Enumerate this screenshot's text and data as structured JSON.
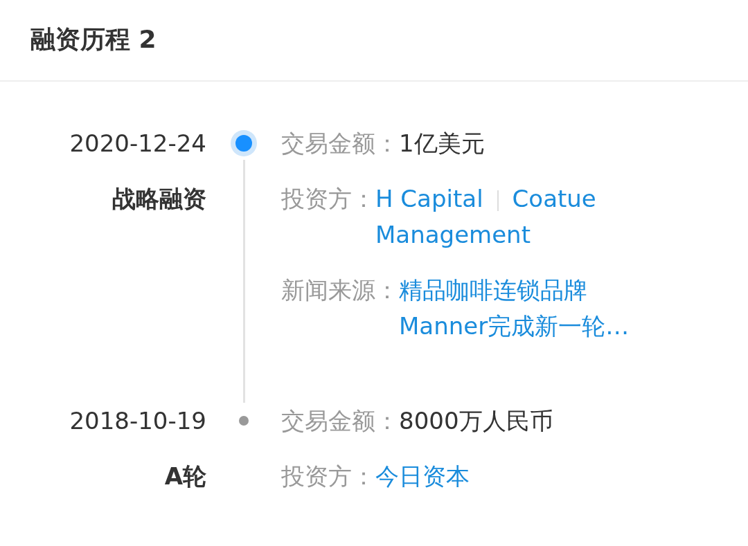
{
  "header": {
    "title": "融资历程 2"
  },
  "events": [
    {
      "date": "2020-12-24",
      "round": "战略融资",
      "active": true,
      "fields": [
        {
          "kind": "text",
          "label": "交易金额：",
          "value": "1亿美元"
        },
        {
          "kind": "links",
          "label": "投资方：",
          "links": [
            "H Capital",
            "Coatue Management"
          ]
        },
        {
          "kind": "link",
          "label": "新闻来源：",
          "value": "精品咖啡连锁品牌Manner完成新一轮…"
        }
      ]
    },
    {
      "date": "2018-10-19",
      "round": "A轮",
      "active": false,
      "fields": [
        {
          "kind": "text",
          "label": "交易金额：",
          "value": "8000万人民币"
        },
        {
          "kind": "links",
          "label": "投资方：",
          "links": [
            "今日资本"
          ]
        }
      ]
    }
  ]
}
